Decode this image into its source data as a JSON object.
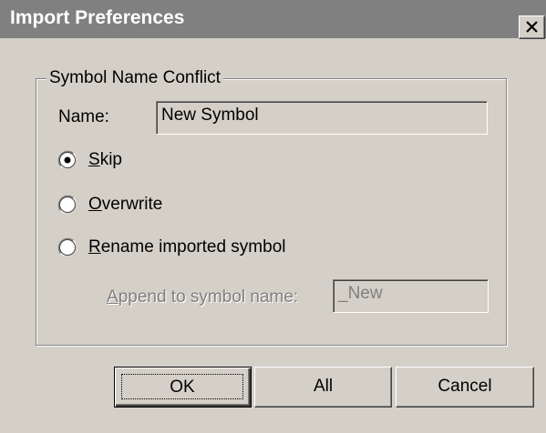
{
  "window": {
    "title": "Import Preferences",
    "close_symbol": "X"
  },
  "group": {
    "label": "Symbol Name Conflict"
  },
  "name": {
    "label": "Name:",
    "value": "New Symbol"
  },
  "options": {
    "skip": {
      "mnemonic": "S",
      "rest": "kip",
      "selected": true
    },
    "overwrite": {
      "mnemonic": "O",
      "rest": "verwrite",
      "selected": false
    },
    "rename": {
      "mnemonic": "R",
      "rest": "ename imported symbol",
      "selected": false
    }
  },
  "append": {
    "label_mnemonic": "A",
    "label_rest": "ppend to symbol name:",
    "value": "_New",
    "enabled": false
  },
  "buttons": {
    "ok": "OK",
    "all": "All",
    "cancel": "Cancel"
  },
  "colors": {
    "dialog_bg": "#d4d0c8",
    "titlebar_bg": "#808080",
    "title_text": "#ffffff",
    "disabled_text": "#808080"
  }
}
